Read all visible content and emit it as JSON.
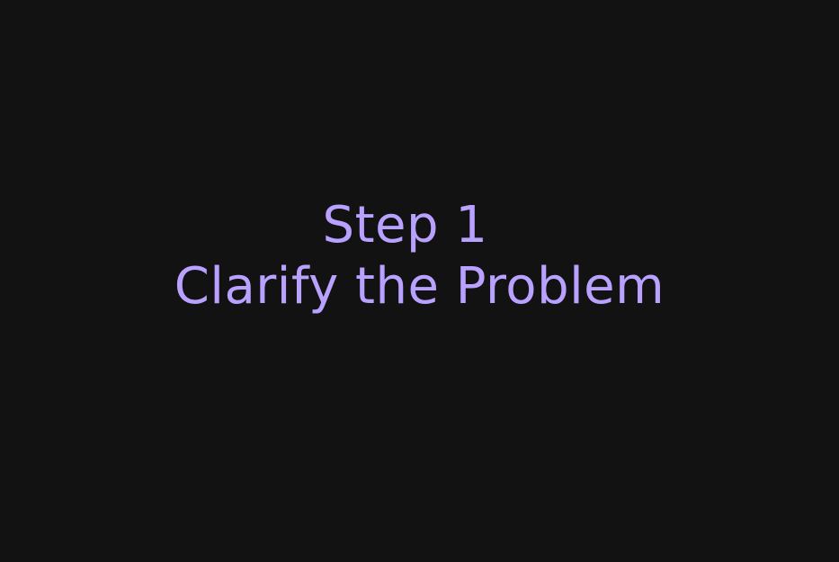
{
  "slide": {
    "step_label": "Step 1",
    "title": "Clarify the Problem",
    "text_color": "#b9a2ff",
    "background_color": "#121212"
  }
}
